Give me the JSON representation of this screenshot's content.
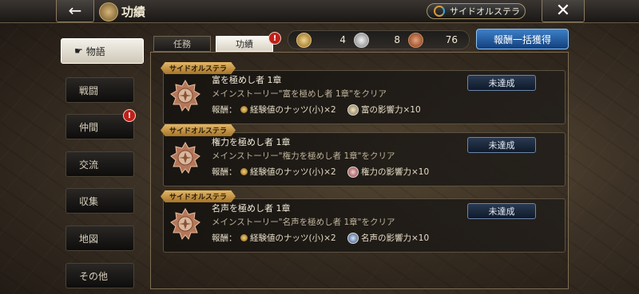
{
  "header": {
    "back_label": "←",
    "title": "功績",
    "world_button": "サイドオルステラ",
    "close_label": "✕"
  },
  "sidebar": {
    "items": [
      {
        "label": "物語",
        "active": true,
        "badge": false
      },
      {
        "label": "戦闘",
        "active": false,
        "badge": false
      },
      {
        "label": "仲間",
        "active": false,
        "badge": true
      },
      {
        "label": "交流",
        "active": false,
        "badge": false
      },
      {
        "label": "収集",
        "active": false,
        "badge": false
      },
      {
        "label": "地図",
        "active": false,
        "badge": false
      },
      {
        "label": "その他",
        "active": false,
        "badge": false
      }
    ],
    "badge_text": "!"
  },
  "tabs": {
    "mission": "任務",
    "achievement": "功績",
    "badge_text": "!"
  },
  "counters": {
    "gold": "4",
    "silver": "8",
    "bronze": "76"
  },
  "claim_all_label": "報酬一括獲得",
  "achievements": [
    {
      "category": "サイドオルステラ",
      "title": "富を極めし者 1章",
      "description": "メインストーリー\"富を極めし者 1章\"をクリア",
      "reward_label": "報酬：",
      "reward1": "経験値のナッツ(小)×2",
      "reward2": "富の影響力×10",
      "reward2_icon": "wealth-influence-icon",
      "status": "未達成"
    },
    {
      "category": "サイドオルステラ",
      "title": "権力を極めし者 1章",
      "description": "メインストーリー\"権力を極めし者 1章\"をクリア",
      "reward_label": "報酬：",
      "reward1": "経験値のナッツ(小)×2",
      "reward2": "権力の影響力×10",
      "reward2_icon": "power-influence-icon",
      "status": "未達成"
    },
    {
      "category": "サイドオルステラ",
      "title": "名声を極めし者 1章",
      "description": "メインストーリー\"名声を極めし者 1章\"をクリア",
      "reward_label": "報酬：",
      "reward1": "経験値のナッツ(小)×2",
      "reward2": "名声の影響力×10",
      "reward2_icon": "fame-influence-icon",
      "status": "未達成"
    }
  ],
  "colors": {
    "ribbon": "#d9a84e",
    "claim_button": "#2a64aa",
    "badge": "#c0201a"
  }
}
